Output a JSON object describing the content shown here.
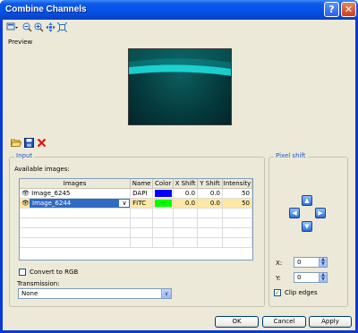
{
  "window": {
    "title": "Combine Channels"
  },
  "toolbar": {
    "icons": [
      "select-icon",
      "zoom-out-icon",
      "zoom-in-icon",
      "pan-icon",
      "fit-icon"
    ]
  },
  "preview": {
    "label": "Preview"
  },
  "actions": {
    "icons": [
      "open-folder-icon",
      "save-icon",
      "delete-icon"
    ]
  },
  "input": {
    "group_label": "Input",
    "available_images_label": "Available images:",
    "columns": [
      "Images",
      "Name",
      "Color",
      "X Shift",
      "Y Shift",
      "Intensity"
    ],
    "rows": [
      {
        "image": "Image_6245",
        "name": "DAPI",
        "color": "#0000ff",
        "color_text": "",
        "x_shift": "0.0",
        "y_shift": "0.0",
        "intensity": "50",
        "selected": false
      },
      {
        "image": "Image_6244",
        "name": "FITC",
        "color": "#00ff00",
        "color_text": "...",
        "x_shift": "0.0",
        "y_shift": "0.0",
        "intensity": "50",
        "selected": true
      }
    ],
    "convert_to_rgb_label": "Convert to RGB",
    "convert_to_rgb_checked": false,
    "transmission_label": "Transmission:",
    "transmission_value": "None"
  },
  "pixel_shift": {
    "group_label": "Pixel shift",
    "x_label": "X:",
    "x_value": "0",
    "y_label": "Y:",
    "y_value": "0",
    "clip_edges_label": "Clip edges",
    "clip_edges_checked": true
  },
  "buttons": {
    "ok": "OK",
    "cancel": "Cancel",
    "apply": "Apply"
  },
  "colors": {
    "accent": "#0a3ad6",
    "selected_row": "#ffe8a6",
    "group_title": "#2157c7"
  }
}
